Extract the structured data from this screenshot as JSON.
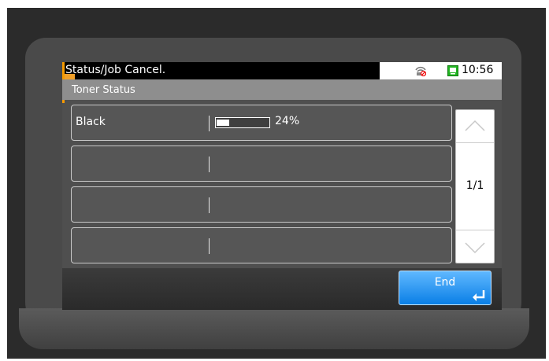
{
  "header": {
    "title": "Status/Job Cancel.",
    "clock": "10:56"
  },
  "subtitle": "Toner Status",
  "rows": [
    {
      "label": "Black",
      "level_percent": 24,
      "percent_text": "24%"
    },
    {
      "label": ""
    },
    {
      "label": ""
    },
    {
      "label": ""
    }
  ],
  "pager": {
    "text": "1/1"
  },
  "footer": {
    "end_label": "End"
  },
  "icons": {
    "network": "network-disconnected-icon",
    "status": "monitor-icon",
    "scroll_up": "chevron-up-icon",
    "scroll_down": "chevron-down-icon",
    "enter": "enter-icon"
  },
  "colors": {
    "accent": "#f59a00",
    "end_button": "#0a7fe6",
    "status_icon": "#22b422"
  }
}
